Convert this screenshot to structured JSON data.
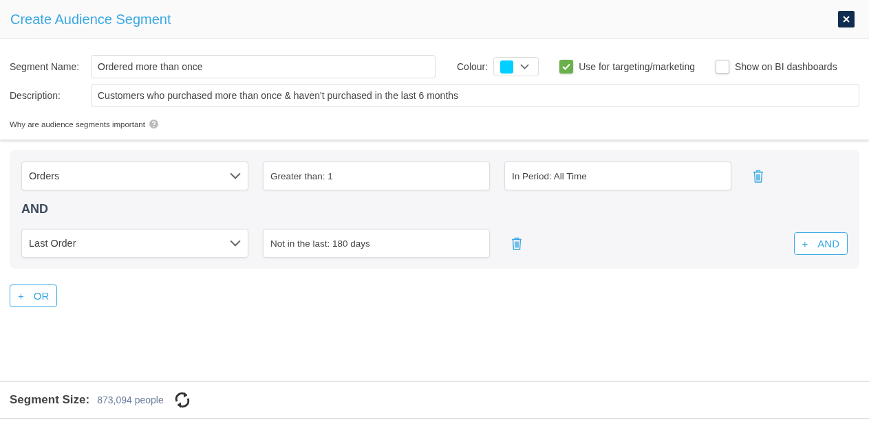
{
  "window": {
    "title": "Create Audience Segment"
  },
  "form": {
    "segment_name": {
      "label": "Segment Name:",
      "value": "Ordered more than once"
    },
    "colour": {
      "label": "Colour:",
      "color": "#00cfff"
    },
    "options": [
      {
        "label": "Use for targeting/marketing",
        "checked": true
      },
      {
        "label": "Show on BI dashboards",
        "checked": false
      }
    ],
    "description": {
      "label": "Description:",
      "value": "Customers who purchased more than once & haven't purchased in the last 6 months"
    },
    "help_link": "Why are audience segments important"
  },
  "rule_group": {
    "conditions": [
      {
        "fields": [
          {
            "kind": "select",
            "value": "Orders"
          },
          {
            "kind": "text",
            "value": "Greater than: 1"
          },
          {
            "kind": "text",
            "value": "In Period: All Time"
          }
        ]
      },
      {
        "fields": [
          {
            "kind": "select",
            "value": "Last Order"
          },
          {
            "kind": "text",
            "value": "Not in the last: 180 days"
          }
        ]
      }
    ],
    "connector": "AND",
    "add_button": {
      "icon": "+",
      "label": "AND"
    }
  },
  "or_button": {
    "icon": "+",
    "label": "OR"
  },
  "footer": {
    "label": "Segment Size:",
    "value": "873,094 people"
  }
}
